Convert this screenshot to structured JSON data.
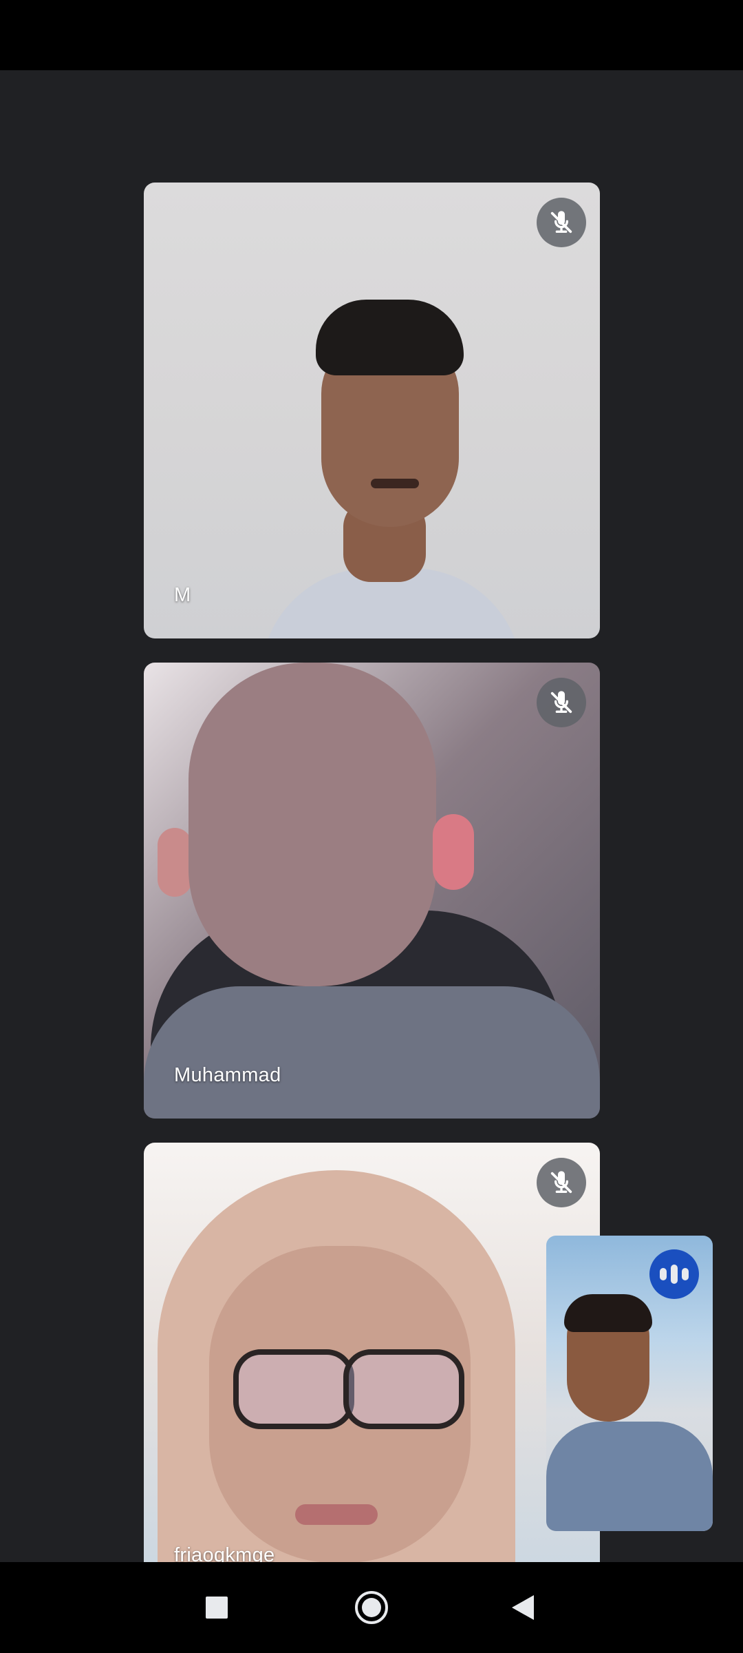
{
  "participants": [
    {
      "name": "M",
      "muted": true
    },
    {
      "name": "Muhammad",
      "muted": true
    },
    {
      "name": "friaoqkmge",
      "muted": true
    }
  ],
  "self_view": {
    "speaking": true
  },
  "icons": {
    "mute": "mic-off-icon",
    "speaking": "audio-level-icon",
    "recents": "square-icon",
    "home": "circle-icon",
    "back": "triangle-back-icon"
  },
  "colors": {
    "stage_background": "#202124",
    "status_bar": "#000000",
    "speaking_accent": "#1a4fbf",
    "mute_button": "#5f6368"
  }
}
